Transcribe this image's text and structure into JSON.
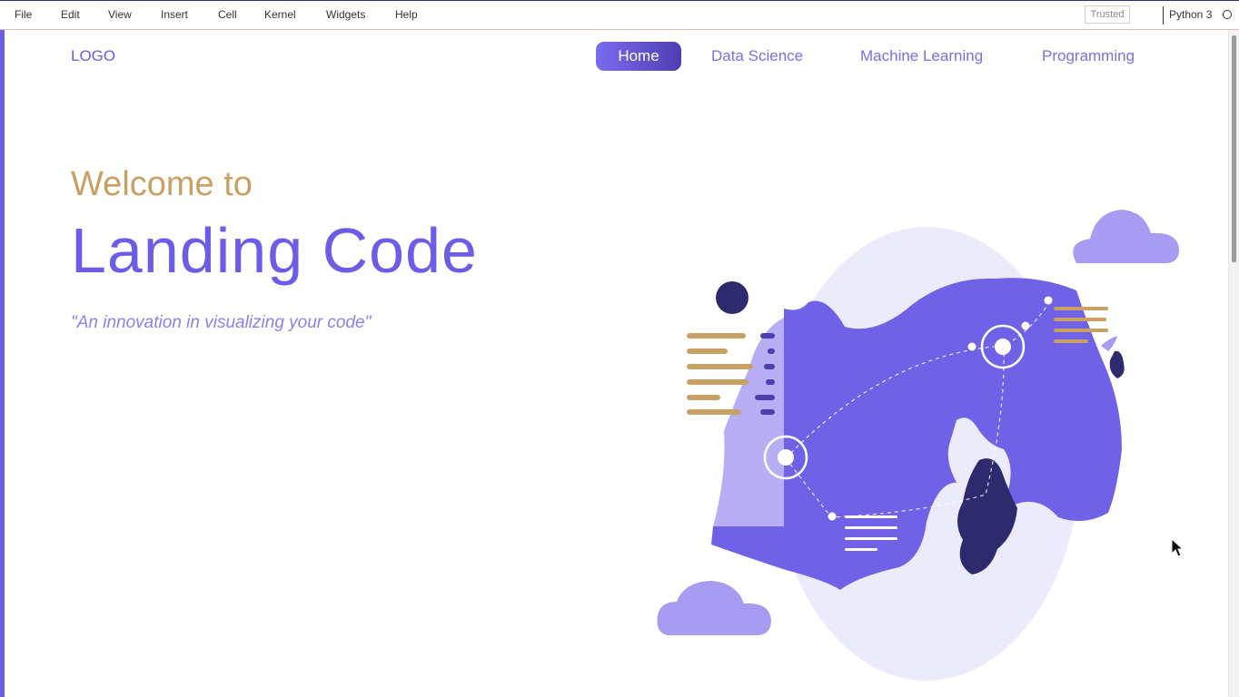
{
  "menubar": {
    "items": [
      "File",
      "Edit",
      "View",
      "Insert",
      "Cell",
      "Kernel",
      "Widgets",
      "Help"
    ],
    "trusted": "Trusted",
    "kernel": "Python 3"
  },
  "landing": {
    "logo": "LOGO",
    "nav": [
      "Home",
      "Data Science",
      "Machine Learning",
      "Programming"
    ],
    "active_nav": "Home",
    "welcome": "Welcome to",
    "title": "Landing Code",
    "tagline": "\"An innovation in visualizing your code\""
  },
  "colors": {
    "accent": "#6c5ce7",
    "gold": "#c9a063",
    "navy": "#2d2a6e",
    "lavender_bg": "#ecebfb"
  }
}
